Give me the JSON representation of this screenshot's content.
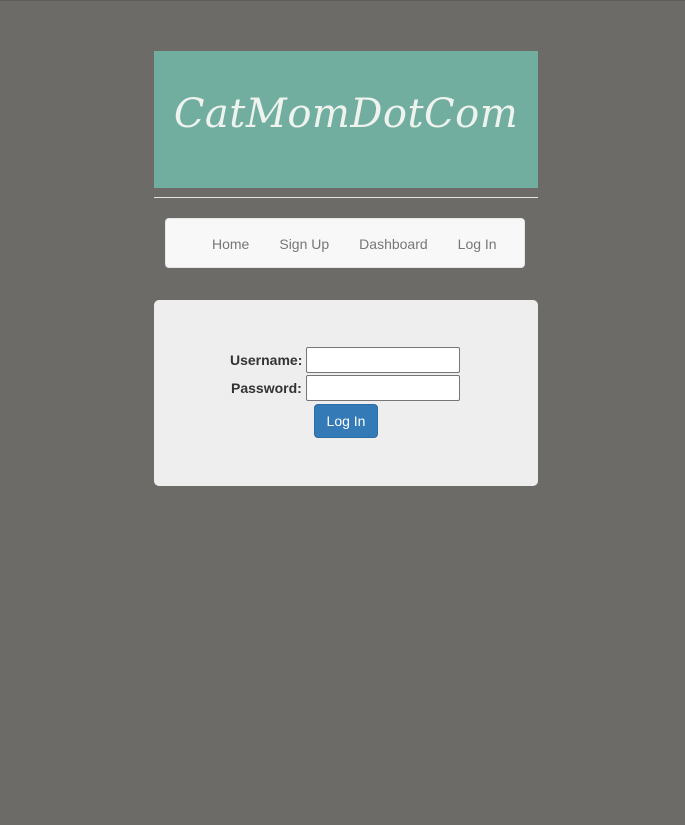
{
  "header": {
    "site_title": "CatMomDotCom"
  },
  "nav": {
    "items": [
      {
        "label": "Home"
      },
      {
        "label": "Sign Up"
      },
      {
        "label": "Dashboard"
      },
      {
        "label": "Log In"
      }
    ]
  },
  "login_form": {
    "username_label": "Username:",
    "username_value": "",
    "password_label": "Password:",
    "password_value": "",
    "submit_label": "Log In"
  },
  "colors": {
    "page_background": "#6d6b67",
    "banner_background": "#72ae9f",
    "navbar_background": "#f8f8f8",
    "panel_background": "#eeeeee",
    "button_primary": "#337ab7"
  }
}
